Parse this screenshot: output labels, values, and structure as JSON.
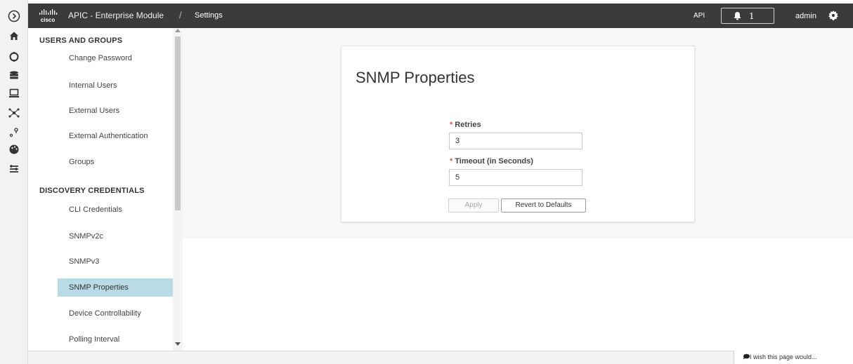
{
  "rail": {
    "icons": [
      "expand-icon",
      "home-icon",
      "topology-icon",
      "database-icon",
      "device-icon",
      "network-icon",
      "location-icon",
      "palette-icon",
      "policy-icon"
    ]
  },
  "topbar": {
    "logo_text": "cisco",
    "app_name": "APIC - Enterprise Module",
    "separator": "/",
    "breadcrumb": "Settings",
    "api_label": "API",
    "alerts_count": "1",
    "user": "admin"
  },
  "sidebar": {
    "sections": [
      {
        "title": "USERS AND GROUPS",
        "items": [
          "Change Password",
          "Internal Users",
          "External Users",
          "External Authentication",
          "Groups"
        ]
      },
      {
        "title": "DISCOVERY CREDENTIALS",
        "items": [
          "CLI Credentials",
          "SNMPv2c",
          "SNMPv3",
          "SNMP Properties",
          "Device Controllability",
          "Polling Interval"
        ]
      }
    ],
    "active_item": "SNMP Properties"
  },
  "form": {
    "title": "SNMP Properties",
    "required_mark": "*",
    "retries_label": "Retries",
    "retries_value": "3",
    "timeout_label": "Timeout (in Seconds)",
    "timeout_value": "5",
    "apply_label": "Apply",
    "revert_label": "Revert to Defaults"
  },
  "footer": {
    "feedback": "I wish this page would..."
  },
  "colors": {
    "topbar": "#3b3b3b",
    "active_item": "#b9dbe6",
    "required": "#d9534f"
  }
}
